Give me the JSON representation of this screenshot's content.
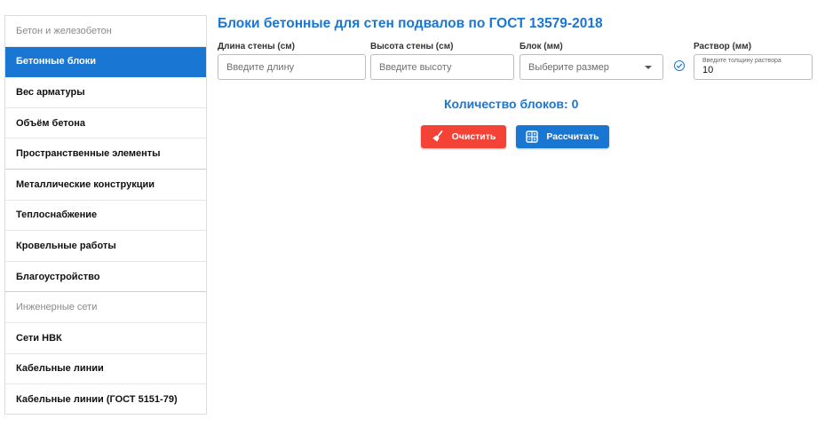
{
  "sidebar": {
    "items": [
      {
        "label": "Бетон и железобетон",
        "type": "section"
      },
      {
        "label": "Бетонные блоки",
        "type": "active"
      },
      {
        "label": "Вес арматуры",
        "type": "item"
      },
      {
        "label": "Объём бетона",
        "type": "item"
      },
      {
        "label": "Пространственные элементы",
        "type": "item"
      },
      {
        "label": "Металлические конструкции",
        "type": "item"
      },
      {
        "label": "Теплоснабжение",
        "type": "item"
      },
      {
        "label": "Кровельные работы",
        "type": "item"
      },
      {
        "label": "Благоустройство",
        "type": "item"
      },
      {
        "label": "Инженерные сети",
        "type": "section"
      },
      {
        "label": "Сети НВК",
        "type": "item"
      },
      {
        "label": "Кабельные линии",
        "type": "item"
      },
      {
        "label": "Кабельные линии (ГОСТ 5151-79)",
        "type": "item"
      }
    ]
  },
  "main": {
    "title": "Блоки бетонные для стен подвалов по ГОСТ 13579-2018",
    "fields": {
      "length": {
        "label": "Длина стены (см)",
        "placeholder": "Введите длину",
        "value": ""
      },
      "height": {
        "label": "Высота стены (см)",
        "placeholder": "Введите высоту",
        "value": ""
      },
      "block": {
        "label": "Блок (мм)",
        "selected": "Выберите размер"
      },
      "mortar": {
        "label": "Раствор (мм)",
        "hint": "Введите толщину раствора",
        "value": "10"
      }
    },
    "count_text": "Количество блоков: 0",
    "buttons": {
      "clear": "Очистить",
      "calculate": "Рассчитать"
    }
  },
  "colors": {
    "accent": "#1976d2",
    "danger": "#f44336"
  },
  "icons": {
    "clear": "broom-icon",
    "calculate": "calculator-icon",
    "mortar_check": "check-circle-icon",
    "select": "caret-down-icon"
  }
}
